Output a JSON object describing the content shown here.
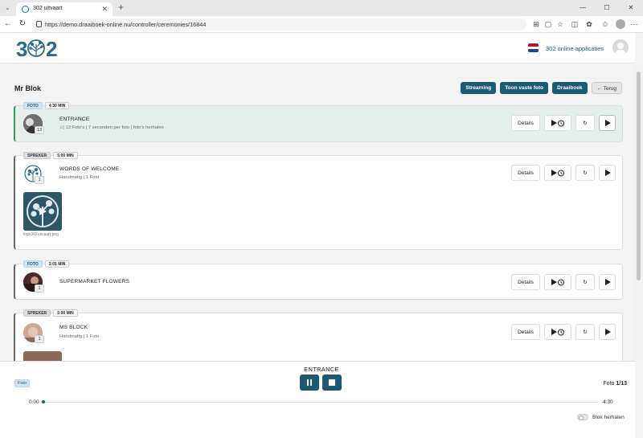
{
  "browser": {
    "tab_title": "302 uitvaart",
    "url": "https://demo.draaiboek-online.nu/controller/ceremonies/16844"
  },
  "header": {
    "logo_text": "302",
    "apps_label": "302 online applicaties",
    "flag_colors": [
      "#ae1c28",
      "#ffffff",
      "#21468b"
    ]
  },
  "page": {
    "title": "Mr Blok",
    "buttons": {
      "streaming": "Streaming",
      "toon_vaste_foto": "Toon vaste foto",
      "draaiboek": "Draaiboek",
      "terug": "Terug"
    }
  },
  "items": [
    {
      "type": "FOTO",
      "duration": "4:30 MIN",
      "title": "ENTRANCE",
      "subtitle": "| 13 Foto's | 7 seconden per foto | foto's herhalen",
      "count": "13",
      "details_label": "Details",
      "active": true
    },
    {
      "type": "SPREKER",
      "duration": "5:00 MIN",
      "title": "WORDS OF WELCOME",
      "subtitle": "Handmatig | 1 Foto",
      "count": "1",
      "details_label": "Details",
      "media_caption": "logo302uitvaart.png"
    },
    {
      "type": "FOTO",
      "duration": "3:01 MIN",
      "title": "SUPERMARKET FLOWERS",
      "subtitle": "",
      "count": "1",
      "details_label": "Details"
    },
    {
      "type": "SPREKER",
      "duration": "5:00 MIN",
      "title": "MS BLOCK",
      "subtitle": "Handmatig | 1 Foto",
      "count": "1",
      "details_label": "Details"
    }
  ],
  "player": {
    "title": "ENTRANCE",
    "type": "Foto",
    "counter_label": "Foto",
    "counter_value": "1/13",
    "time_start": "0:00",
    "time_end": "4:30",
    "progress": 0,
    "repeat_label": "Blok herhalen",
    "repeat_on": false
  },
  "colors": {
    "primary": "#1d5a72",
    "active_green": "#2f9b62",
    "active_bg": "#e6efec"
  }
}
